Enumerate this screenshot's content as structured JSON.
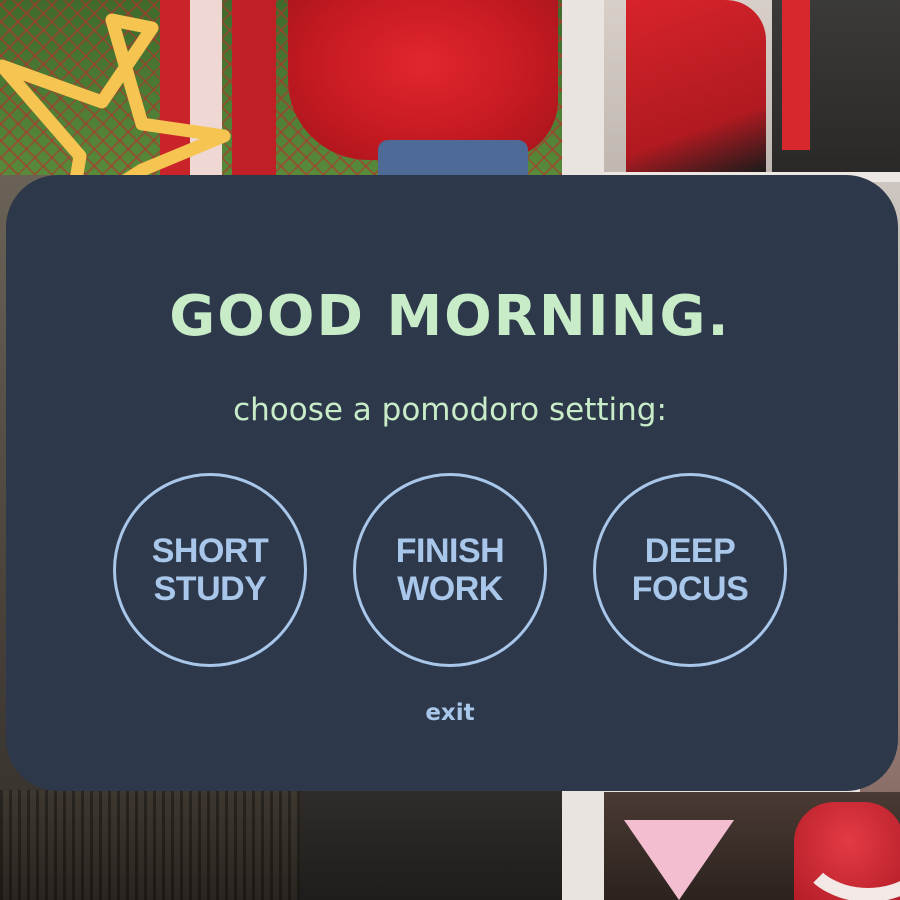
{
  "greeting": "GOOD MORNING.",
  "subtitle": "choose a pomodoro setting:",
  "options": [
    {
      "line1": "SHORT",
      "line2": "STUDY"
    },
    {
      "line1": "FINISH",
      "line2": "WORK"
    },
    {
      "line1": "DEEP",
      "line2": "FOCUS"
    }
  ],
  "exit_label": "exit",
  "colors": {
    "dialog_bg": "#2d384a",
    "greeting_text": "#c8ecc8",
    "option_accent": "#a9c7ea",
    "star_doodle": "#f5c451"
  },
  "icons": {
    "star": "star-doodle-icon"
  }
}
